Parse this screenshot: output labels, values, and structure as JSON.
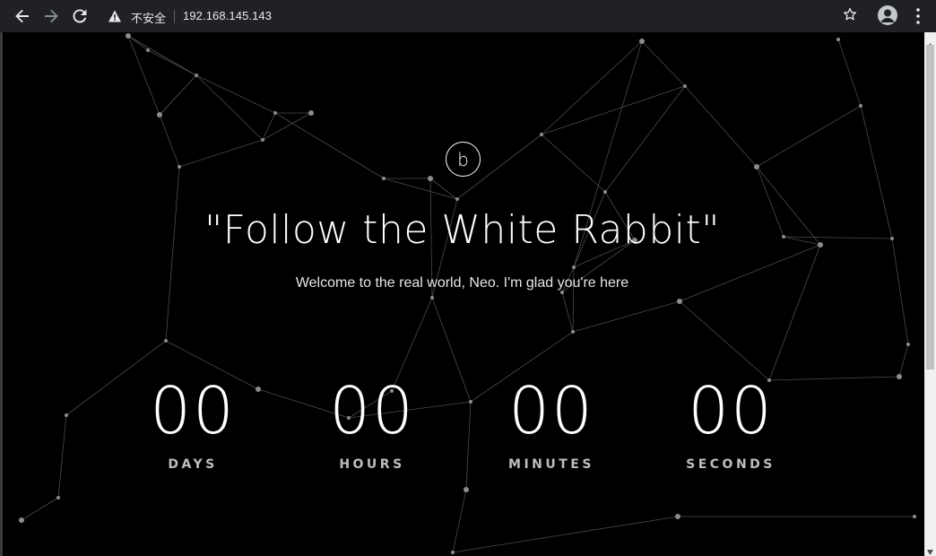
{
  "browser": {
    "security_label": "不安全",
    "url": "192.168.145.143",
    "icons": {
      "back": "arrow-left-icon",
      "forward": "arrow-right-icon",
      "reload": "reload-icon",
      "warning": "warning-triangle-icon",
      "bookmark": "star-icon",
      "profile": "profile-avatar-icon",
      "menu": "three-dot-menu-icon"
    }
  },
  "page": {
    "logo_letter": "b",
    "title": "\"Follow the White Rabbit\"",
    "subtitle": "Welcome to the real world, Neo. I'm glad you're here",
    "countdown": [
      {
        "value": "00",
        "label": "DAYS"
      },
      {
        "value": "00",
        "label": "HOURS"
      },
      {
        "value": "00",
        "label": "MINUTES"
      },
      {
        "value": "00",
        "label": "SECONDS"
      }
    ]
  },
  "colors": {
    "chrome_bg": "#202124",
    "page_bg": "#000000",
    "text": "#ffffff",
    "label": "#bdbdbd",
    "network_line": "#5a5a5a",
    "network_node": "#9a9a9a"
  }
}
